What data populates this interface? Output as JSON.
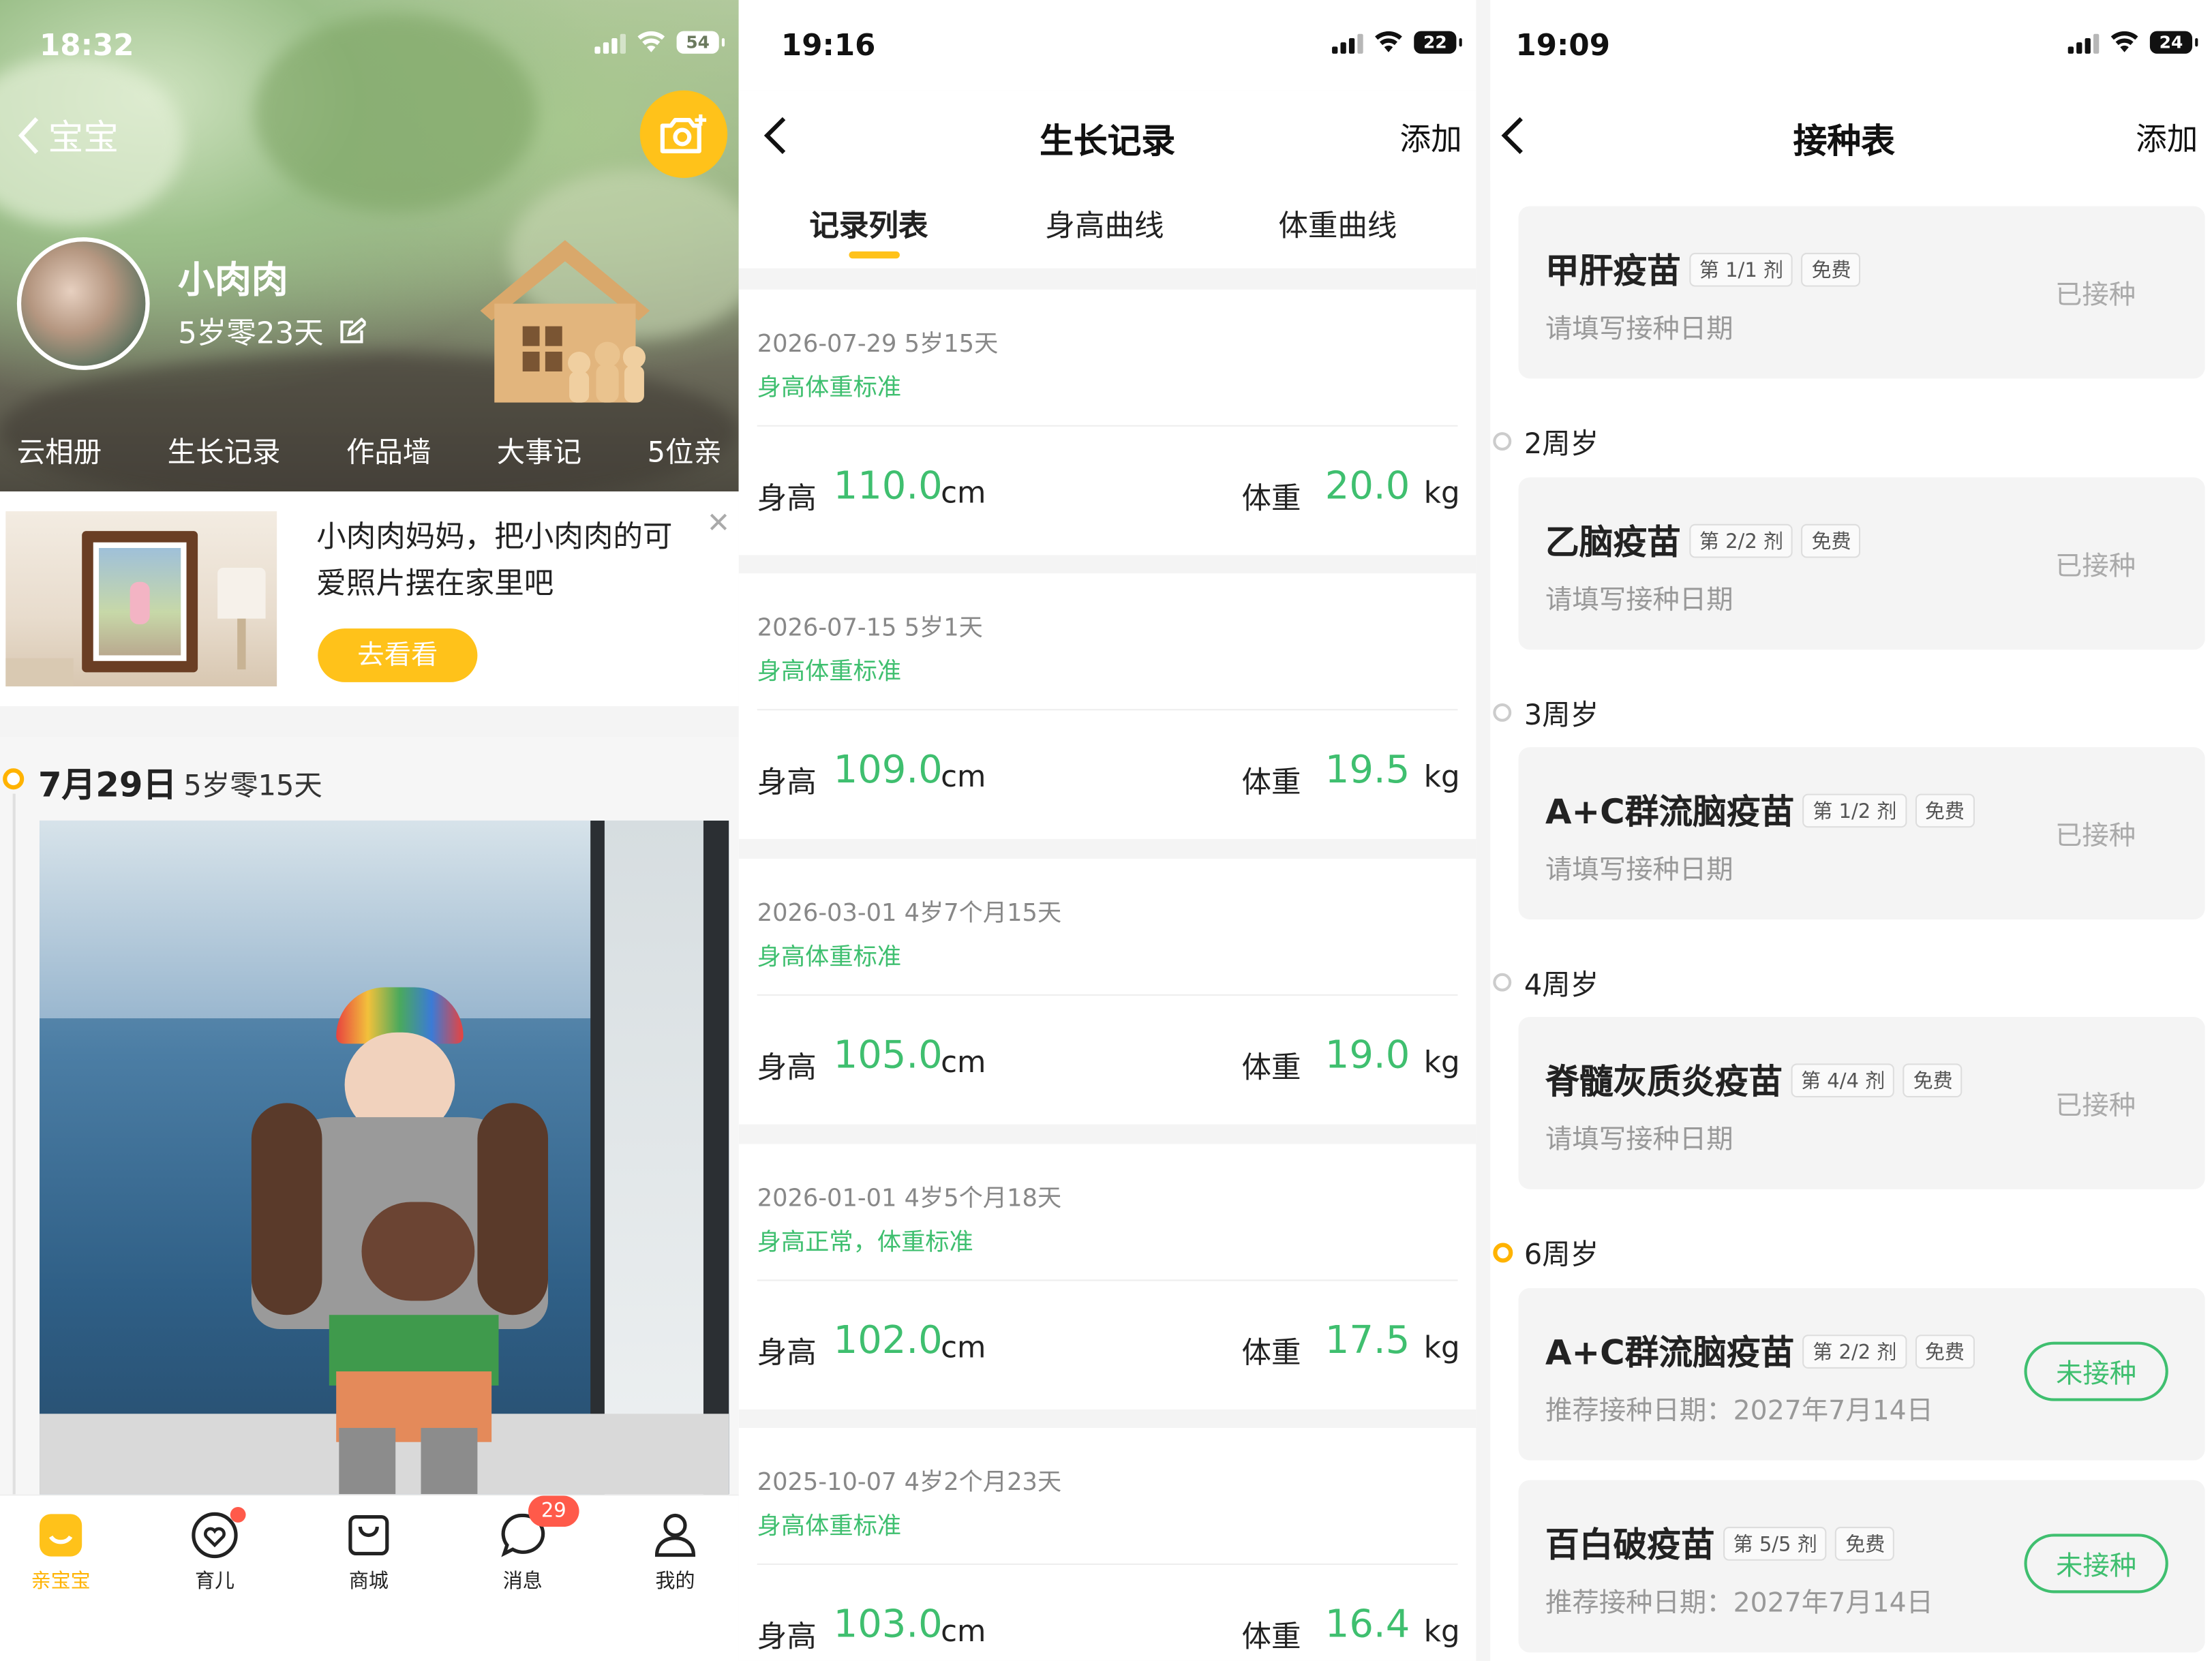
{
  "baby_home": {
    "status": {
      "time": "18:32",
      "battery": "54"
    },
    "back_label": "宝宝",
    "baby_name": "小肉肉",
    "baby_age": "5岁零23天",
    "nav": [
      "云相册",
      "生长记录",
      "作品墙",
      "大事记",
      "5位亲"
    ],
    "promo": {
      "text": "小肉肉妈妈，把小肉肉的可爱照片摆在家里吧",
      "button": "去看看"
    },
    "timeline": {
      "date": "7月29日",
      "age": "5岁零15天"
    },
    "tabs": [
      {
        "label": "亲宝宝",
        "icon": "home-icon",
        "active": true
      },
      {
        "label": "育儿",
        "icon": "parenting-icon",
        "dot": true
      },
      {
        "label": "商城",
        "icon": "shopping-bag-icon"
      },
      {
        "label": "消息",
        "icon": "message-icon",
        "badge": "29"
      },
      {
        "label": "我的",
        "icon": "profile-icon"
      }
    ],
    "colors": {
      "accent": "#ffc21a"
    }
  },
  "growth": {
    "status": {
      "time": "19:16",
      "battery": "22"
    },
    "title": "生长记录",
    "action": "添加",
    "tabs": [
      "记录列表",
      "身高曲线",
      "体重曲线"
    ],
    "height_label": "身高",
    "weight_label": "体重",
    "height_unit": "cm",
    "weight_unit": "kg",
    "records": [
      {
        "date": "2026-07-29 5岁15天",
        "tag": "身高体重标准",
        "height": "110.0",
        "weight": "20.0"
      },
      {
        "date": "2026-07-15 5岁1天",
        "tag": "身高体重标准",
        "height": "109.0",
        "weight": "19.5"
      },
      {
        "date": "2026-03-01 4岁7个月15天",
        "tag": "身高体重标准",
        "height": "105.0",
        "weight": "19.0"
      },
      {
        "date": "2026-01-01 4岁5个月18天",
        "tag": "身高正常，体重标准",
        "height": "102.0",
        "weight": "17.5"
      },
      {
        "date": "2025-10-07 4岁2个月23天",
        "tag": "身高体重标准",
        "height": "103.0",
        "weight": "16.4"
      }
    ],
    "colors": {
      "value": "#3fbf6f"
    }
  },
  "vaccine": {
    "status": {
      "time": "19:09",
      "battery": "24"
    },
    "title": "接种表",
    "action": "添加",
    "free_label": "免费",
    "groups": [
      {
        "age": "",
        "items": [
          {
            "name": "甲肝疫苗",
            "dose": "第 1/1 剂",
            "sub": "请填写接种日期",
            "status": "已接种",
            "done": true
          }
        ]
      },
      {
        "age": "2周岁",
        "items": [
          {
            "name": "乙脑疫苗",
            "dose": "第 2/2 剂",
            "sub": "请填写接种日期",
            "status": "已接种",
            "done": true
          }
        ]
      },
      {
        "age": "3周岁",
        "items": [
          {
            "name": "A+C群流脑疫苗",
            "dose": "第 1/2 剂",
            "sub": "请填写接种日期",
            "status": "已接种",
            "done": true
          }
        ]
      },
      {
        "age": "4周岁",
        "items": [
          {
            "name": "脊髓灰质炎疫苗",
            "dose": "第 4/4 剂",
            "sub": "请填写接种日期",
            "status": "已接种",
            "done": true
          }
        ]
      },
      {
        "age": "6周岁",
        "current": true,
        "items": [
          {
            "name": "A+C群流脑疫苗",
            "dose": "第 2/2 剂",
            "sub": "推荐接种日期：2027年7月14日",
            "status": "未接种",
            "done": false
          },
          {
            "name": "百白破疫苗",
            "dose": "第 5/5 剂",
            "sub": "推荐接种日期：2027年7月14日",
            "status": "未接种",
            "done": false
          }
        ]
      }
    ]
  }
}
